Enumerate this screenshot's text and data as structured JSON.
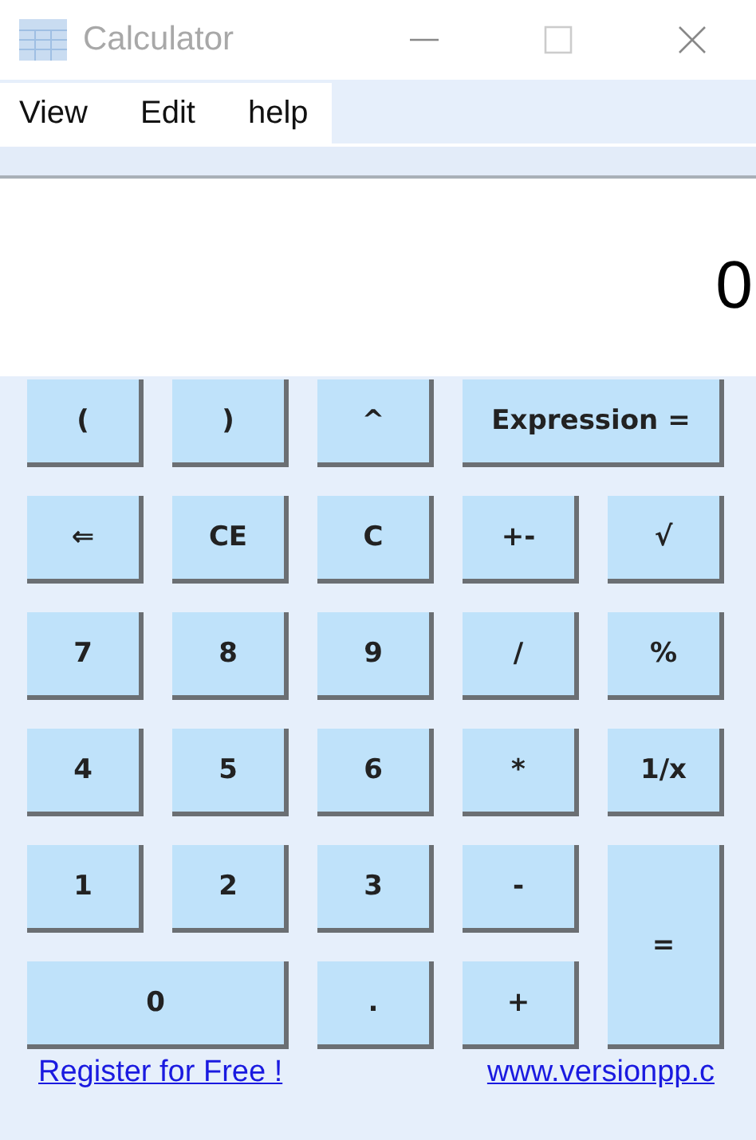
{
  "window": {
    "title": "Calculator"
  },
  "menu": [
    {
      "label": "View"
    },
    {
      "label": "Edit"
    },
    {
      "label": "help"
    }
  ],
  "display": {
    "value": "0"
  },
  "keys": [
    {
      "label": "(",
      "kind": "normal"
    },
    {
      "label": ")",
      "kind": "normal"
    },
    {
      "label": "^",
      "kind": "normal"
    },
    {
      "label": "Expression =",
      "kind": "wide"
    },
    {
      "label": "⇐",
      "kind": "normal"
    },
    {
      "label": "CE",
      "kind": "normal"
    },
    {
      "label": "C",
      "kind": "normal"
    },
    {
      "label": "+-",
      "kind": "normal"
    },
    {
      "label": "√",
      "kind": "normal"
    },
    {
      "label": "7",
      "kind": "normal"
    },
    {
      "label": "8",
      "kind": "normal"
    },
    {
      "label": "9",
      "kind": "normal"
    },
    {
      "label": "/",
      "kind": "normal"
    },
    {
      "label": "%",
      "kind": "normal"
    },
    {
      "label": "4",
      "kind": "normal"
    },
    {
      "label": "5",
      "kind": "normal"
    },
    {
      "label": "6",
      "kind": "normal"
    },
    {
      "label": "*",
      "kind": "normal"
    },
    {
      "label": "1/x",
      "kind": "normal"
    },
    {
      "label": "1",
      "kind": "normal"
    },
    {
      "label": "2",
      "kind": "normal"
    },
    {
      "label": "3",
      "kind": "normal"
    },
    {
      "label": "-",
      "kind": "normal"
    },
    {
      "label": "=",
      "kind": "tall"
    },
    {
      "label": "0",
      "kind": "wide"
    },
    {
      "label": ".",
      "kind": "normal"
    },
    {
      "label": "+",
      "kind": "normal"
    }
  ],
  "links": [
    {
      "label": "Register for Free !"
    },
    {
      "label": "www.versionpp.c"
    }
  ]
}
